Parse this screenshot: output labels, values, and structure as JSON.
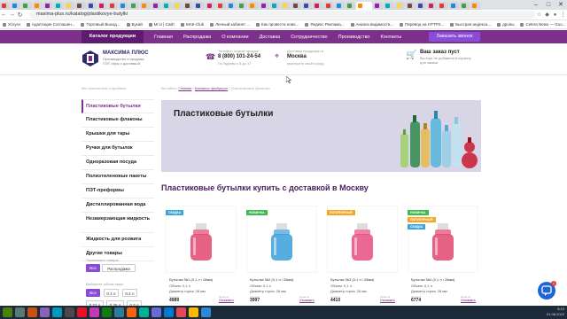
{
  "browser": {
    "url": "maxima-plus.ru/katalog/plastikovye-butylki",
    "bookmarks": [
      "Услуги",
      "Адаптация Соглашен...",
      "Торговый Выход...",
      "Букай",
      "Mi U | Сайт",
      "МАК-Club",
      "Личный кабинет ...",
      "Как провести ново...",
      "Яндекс Реклама...",
      "Анализ видимости...",
      "Перевод на HTTPS...",
      "Быстрая индекса...",
      "дропы",
      "Celera News — Goo..."
    ],
    "more_label": "»"
  },
  "nav": {
    "catalog": "Каталог продукции",
    "links": [
      "Главная",
      "Распродажа",
      "О компании",
      "Доставка",
      "Сотрудничество",
      "Производство",
      "Контакты"
    ],
    "call": "Заказать звонок"
  },
  "header": {
    "brand": "МАКСИМА ПЛЮС",
    "brand_sub": "Производство и продажа ПЭТ-тары с доставкой",
    "phone_label": "Телефон отдела продаж",
    "phone": "8 (800) 101-24-54",
    "hours": "По будням с 8 до 17",
    "loc_label": "Доставка продукции в",
    "city": "Москва",
    "city_select": "(выберите свой город)",
    "cart_title": "Ваш заказ пуст",
    "cart_sub": "Вы еще не добавили в корзину для заказа"
  },
  "breadcrumbs": {
    "left": "Мы производим и продаем",
    "prefix": "Вы здесь:",
    "items": [
      "Главная",
      "Каталог продукции"
    ],
    "current": "Пластиковые бутылки"
  },
  "sidebar": {
    "items": [
      "Пластиковые бутылки",
      "Пластиковые флаконы",
      "Крышки для тары",
      "Ручки для бутылок",
      "Одноразовая посуда",
      "Полиэтиленовые пакеты",
      "ПЭТ-преформы",
      "Дистиллированная вода",
      "Незамерзающая жидкость",
      "Жидкость для розжига",
      "Другие товары"
    ],
    "filter_label": "Показывать товары:",
    "filter_all": "Все",
    "filter_sale": "Распродажа",
    "volume_label": "Выберите объем тары:",
    "volumes": [
      "Все",
      "0.1 л",
      "0.2 л",
      "0.22 л",
      "0.25 л",
      "0.3 л"
    ]
  },
  "main": {
    "banner_title": "Пластиковые бутылки",
    "heading": "Пластиковые бутылки купить с доставкой в Москву",
    "products": [
      {
        "badges": [
          "СКИДКА"
        ],
        "name": "Бутылка №1 (0,1 л / 28мм)",
        "volume": "Объем: 0,1 л",
        "neck": "Диаметр горла: 28 мм",
        "price_label": "Артикул",
        "price": "4989",
        "link_label": "Цена за уточняйте",
        "link": "Уточнить",
        "color": "#e2466f"
      },
      {
        "badges": [
          "НОВИНКА"
        ],
        "name": "Бутылка №2 (0,1 л / 28мм)",
        "volume": "Объем: 0,1 л",
        "neck": "Диаметр горла: 28 мм",
        "price_label": "Артикул",
        "price": "3997",
        "link_label": "Цена за уточняйте",
        "link": "Уточнить",
        "color": "#3a9fd9"
      },
      {
        "badges": [
          "ПОПУЛЯРНЫЙ"
        ],
        "name": "Бутылка №3 (0,1 л / 28мм)",
        "volume": "Объем: 0,1 л",
        "neck": "Диаметр горла: 28 мм",
        "price_label": "Артикул",
        "price": "4410",
        "link_label": "Цена за уточняйте",
        "link": "Уточнить",
        "color": "#e54f80"
      },
      {
        "badges": [
          "НОВИНКА",
          "ПОПУЛЯРНЫЙ",
          "СКИДКА"
        ],
        "name": "Бутылка №4 (0,1 л / 28мм)",
        "volume": "Объем: 0,1 л",
        "neck": "Диаметр горла: 28 мм",
        "price_label": "Артикул",
        "price": "6774",
        "link_label": "Цена за уточняйте",
        "link": "Уточнить",
        "color": "#e2466f"
      }
    ]
  },
  "taskbar": {
    "time": "8:10",
    "date": "01.08.2022"
  },
  "colors": {
    "brand": "#7d2f8c",
    "button": "#8a4bd7",
    "badge_sale": "#3aa7d8",
    "badge_new": "#3dbb4c",
    "badge_popular": "#f5a623"
  }
}
